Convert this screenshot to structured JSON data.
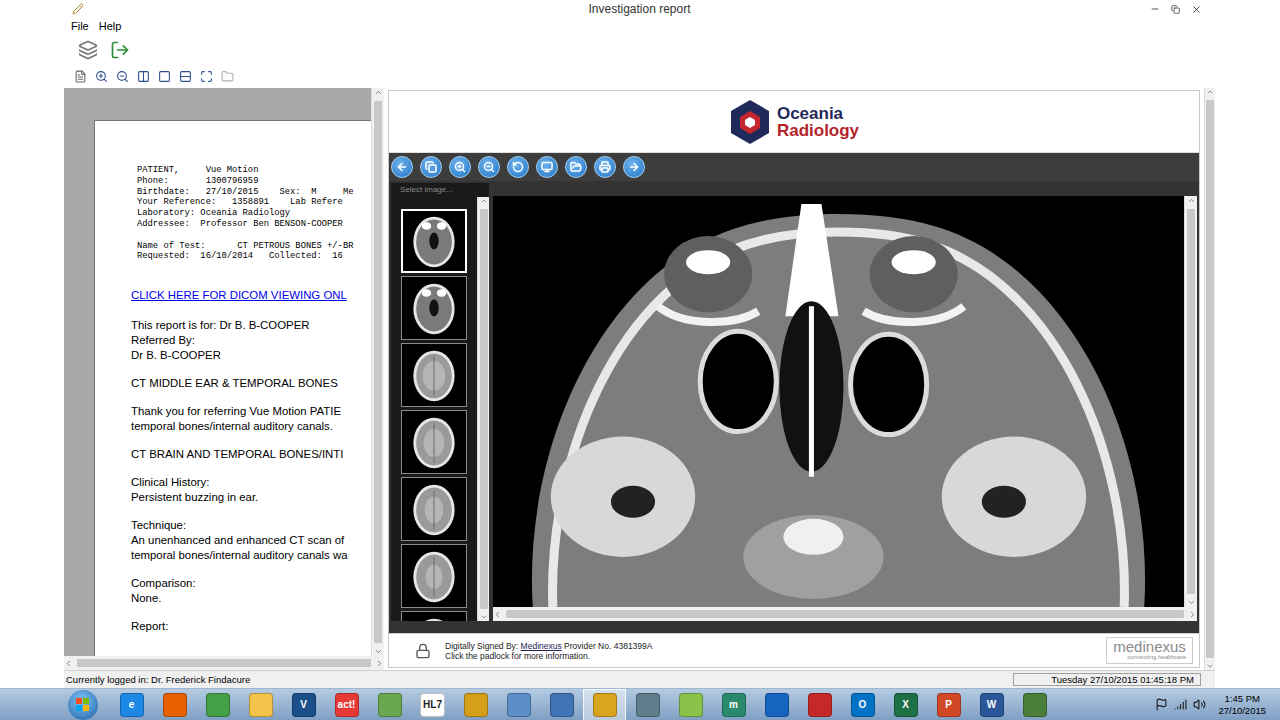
{
  "window": {
    "title": "Investigation report"
  },
  "menu": [
    "File",
    "Help"
  ],
  "document": {
    "header_groups": [
      [
        "PATIENT,     Vue Motion",
        "Phone:       1300796959",
        "Birthdate:   27/10/2015    Sex:  M     Me",
        "Your Reference:   1358891    Lab Refere",
        "Laboratory: Oceania Radiology",
        "Addressee:  Professor Ben BENSON-COOPER"
      ],
      [
        "Name of Test:      CT PETROUS BONES +/-BR",
        "Requested:  16/10/2014   Collected:  16"
      ]
    ],
    "link": "CLICK HERE FOR DICOM VIEWING ONL",
    "paragraphs": [
      [
        "This report is for: Dr B. B-COOPER",
        "Referred By:",
        "Dr B. B-COOPER"
      ],
      [
        "CT MIDDLE EAR & TEMPORAL BONES"
      ],
      [
        "Thank you for referring Vue Motion PATIE",
        "temporal bones/internal auditory canals."
      ],
      [
        "CT BRAIN AND TEMPORAL BONES/INTI"
      ],
      [
        "Clinical History:",
        "Persistent buzzing in ear."
      ],
      [
        "Technique:",
        "An unenhanced and enhanced CT scan of",
        "temporal bones/internal auditory canals wa"
      ],
      [
        "Comparison:",
        "None."
      ],
      [
        "Report:"
      ]
    ]
  },
  "viewer": {
    "logo": {
      "line1": "Oceania",
      "line2": "Radiology"
    },
    "thumbnail_label": "Select image...",
    "thumbnails": [
      {
        "selected": true
      },
      {
        "selected": false
      },
      {
        "selected": false
      },
      {
        "selected": false
      },
      {
        "selected": false
      },
      {
        "selected": false
      },
      {
        "selected": false
      }
    ]
  },
  "signature": {
    "label": "Digitally Signed By:",
    "signer": "Medinexus",
    "provider": "Provider No. 4381399A",
    "note": "Click the padlock for more information.",
    "brand": "medinexus",
    "tagline": "connecting healthcare"
  },
  "status_bar": {
    "user": "Currently logged in: Dr. Frederick Findacure",
    "datetime": "Tuesday 27/10/2015 01:45:18 PM"
  },
  "taskbar": {
    "apps": [
      {
        "label": "e",
        "color": "#1e88e5",
        "active": false
      },
      {
        "label": "",
        "color": "#e66000",
        "active": false
      },
      {
        "label": "",
        "color": "#43a047",
        "active": false
      },
      {
        "label": "",
        "color": "#f3c34a",
        "active": false
      },
      {
        "label": "V",
        "color": "#1a4f8b",
        "active": false
      },
      {
        "label": "act!",
        "color": "#e53935",
        "active": false
      },
      {
        "label": "",
        "color": "#6aa84f",
        "active": false
      },
      {
        "label": "HL7",
        "color": "#ffffff",
        "active": false
      },
      {
        "label": "",
        "color": "#d4a017",
        "active": false
      },
      {
        "label": "",
        "color": "#5c8fc7",
        "active": false
      },
      {
        "label": "",
        "color": "#3f73b5",
        "active": false
      },
      {
        "label": "",
        "color": "#d9a520",
        "active": true
      },
      {
        "label": "",
        "color": "#607d8b",
        "active": false
      },
      {
        "label": "",
        "color": "#8bc34a",
        "active": false
      },
      {
        "label": "m",
        "color": "#2b8a6e",
        "active": false
      },
      {
        "label": "",
        "color": "#1565c0",
        "active": false
      },
      {
        "label": "",
        "color": "#c62828",
        "active": false
      },
      {
        "label": "O",
        "color": "#0072c6",
        "active": false
      },
      {
        "label": "X",
        "color": "#1e7145",
        "active": false
      },
      {
        "label": "P",
        "color": "#d24726",
        "active": false
      },
      {
        "label": "W",
        "color": "#2b579a",
        "active": false
      },
      {
        "label": "",
        "color": "#4a7f3a",
        "active": false
      }
    ],
    "time": "1:45 PM",
    "date": "27/10/2015"
  }
}
